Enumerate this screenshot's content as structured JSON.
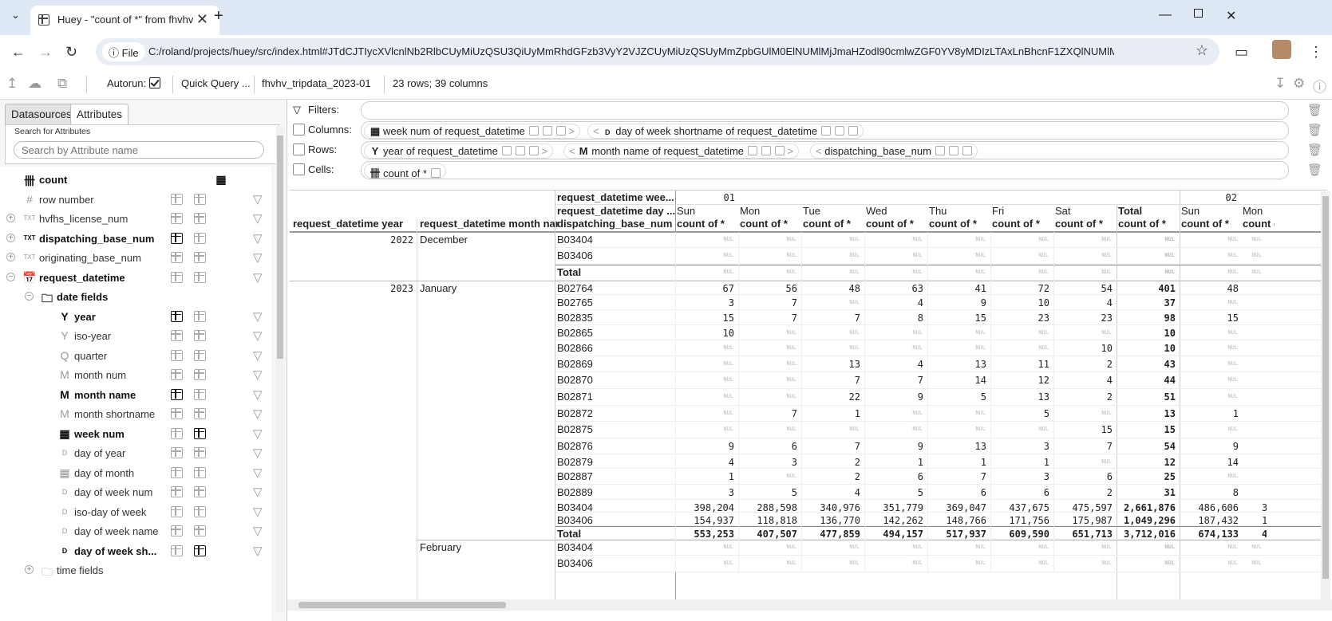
{
  "browser": {
    "tab_title": "Huey - \"count of *\" from fhvhv_",
    "url_chip": "File",
    "url": "C:/roland/projects/huey/src/index.html#JTdCJTIycXVlcnlNb2RlbCUyMiUzQSU3QiUyMmRhdGFzb3VyY2VJZCUyMiUzQSUyMmZpbGUlM0ElNUMlMjJmaHZodl90cmlwZGF0YV8yMDIzLTAxLnBhcnF1ZXQlNUMlMjIl..."
  },
  "app_toolbar": {
    "autorun_label": "Autorun:",
    "quick_query": "Quick Query ...",
    "datasource": "fhvhv_tripdata_2023-01",
    "row_info": "23 rows; 39 columns"
  },
  "sidebar": {
    "tabs": [
      "Datasources",
      "Attributes"
    ],
    "search_label": "Search for Attributes",
    "search_placeholder": "Search by Attribute name",
    "items": [
      {
        "label": "count",
        "icon": "count-icon",
        "glyph": "卌",
        "bold": true,
        "indent": 0
      },
      {
        "label": "row number",
        "icon": "hash-icon",
        "glyph": "#",
        "bold": false,
        "indent": 0
      },
      {
        "label": "hvfhs_license_num",
        "icon": "text-icon",
        "glyph": "TXT",
        "bold": false,
        "indent": 0
      },
      {
        "label": "dispatching_base_num",
        "icon": "text-icon",
        "glyph": "TXT",
        "bold": true,
        "indent": 0
      },
      {
        "label": "originating_base_num",
        "icon": "text-icon",
        "glyph": "TXT",
        "bold": false,
        "indent": 0
      },
      {
        "label": "request_datetime",
        "icon": "datetime-icon",
        "glyph": "📅",
        "bold": true,
        "indent": 0
      },
      {
        "label": "date fields",
        "icon": "folder-icon",
        "glyph": "🗀",
        "bold": true,
        "indent": 1
      },
      {
        "label": "year",
        "icon": "year-icon",
        "glyph": "Y",
        "bold": true,
        "indent": 2
      },
      {
        "label": "iso-year",
        "icon": "year-icon",
        "glyph": "Y",
        "bold": false,
        "indent": 2
      },
      {
        "label": "quarter",
        "icon": "quarter-icon",
        "glyph": "Q",
        "bold": false,
        "indent": 2
      },
      {
        "label": "month num",
        "icon": "month-icon",
        "glyph": "M",
        "bold": false,
        "indent": 2
      },
      {
        "label": "month name",
        "icon": "month-icon",
        "glyph": "M",
        "bold": true,
        "indent": 2
      },
      {
        "label": "month shortname",
        "icon": "month-icon",
        "glyph": "M",
        "bold": false,
        "indent": 2
      },
      {
        "label": "week num",
        "icon": "calendar-icon",
        "glyph": "▦",
        "bold": true,
        "indent": 2
      },
      {
        "label": "day of year",
        "icon": "day-icon",
        "glyph": "D",
        "bold": false,
        "indent": 2
      },
      {
        "label": "day of month",
        "icon": "calendar-icon",
        "glyph": "▦",
        "bold": false,
        "indent": 2
      },
      {
        "label": "day of week num",
        "icon": "day-icon",
        "glyph": "D",
        "bold": false,
        "indent": 2
      },
      {
        "label": "iso-day of week",
        "icon": "day-icon",
        "glyph": "D",
        "bold": false,
        "indent": 2
      },
      {
        "label": "day of week name",
        "icon": "day-icon",
        "glyph": "D",
        "bold": false,
        "indent": 2
      },
      {
        "label": "day of week sh...",
        "icon": "day-icon",
        "glyph": "D",
        "bold": true,
        "indent": 2
      },
      {
        "label": "time fields",
        "icon": "folder-icon",
        "glyph": "🗀",
        "bold": false,
        "indent": 1
      }
    ]
  },
  "query": {
    "filters_label": "Filters:",
    "columns_label": "Columns:",
    "rows_label": "Rows:",
    "cells_label": "Cells:",
    "columns": [
      "week num of request_datetime",
      "day of week shortname of request_datetime"
    ],
    "rows": [
      "year of request_datetime",
      "month name of request_datetime",
      "dispatching_base_num"
    ],
    "cells": [
      "count of *"
    ]
  },
  "pivot": {
    "col_header_week": "request_datetime wee...",
    "col_header_day": "request_datetime day ...",
    "row_headers": [
      "request_datetime year",
      "request_datetime month name",
      "dispatching_base_num"
    ],
    "week1": "01",
    "week2": "02",
    "days": [
      "Sun",
      "Mon",
      "Tue",
      "Wed",
      "Thu",
      "Fri",
      "Sat"
    ],
    "total_label": "Total",
    "measure": "count of *",
    "nul": "NUL",
    "week2_days": [
      "Sun",
      "Mon"
    ],
    "year_2022": "2022",
    "year_2023": "2023",
    "month_dec": "December",
    "month_jan": "January",
    "month_feb": "February",
    "rows": [
      {
        "base": "B03404",
        "v": [
          null,
          null,
          null,
          null,
          null,
          null,
          null
        ],
        "tot": null,
        "w2": [
          null,
          null
        ]
      },
      {
        "base": "B03406",
        "v": [
          null,
          null,
          null,
          null,
          null,
          null,
          null
        ],
        "tot": null,
        "w2": [
          null,
          null
        ]
      },
      {
        "base": "Total",
        "v": [
          null,
          null,
          null,
          null,
          null,
          null,
          null
        ],
        "tot": null,
        "w2": [
          null,
          null
        ]
      },
      {
        "base": "B02764",
        "v": [
          "67",
          "56",
          "48",
          "63",
          "41",
          "72",
          "54"
        ],
        "tot": "401",
        "w2": [
          "48",
          ""
        ]
      },
      {
        "base": "B02765",
        "v": [
          "3",
          "7",
          null,
          "4",
          "9",
          "10",
          "4"
        ],
        "tot": "37",
        "w2": [
          null,
          ""
        ]
      },
      {
        "base": "B02835",
        "v": [
          "15",
          "7",
          "7",
          "8",
          "15",
          "23",
          "23"
        ],
        "tot": "98",
        "w2": [
          "15",
          ""
        ]
      },
      {
        "base": "B02865",
        "v": [
          "10",
          null,
          null,
          null,
          null,
          null,
          null
        ],
        "tot": "10",
        "w2": [
          null,
          ""
        ]
      },
      {
        "base": "B02866",
        "v": [
          null,
          null,
          null,
          null,
          null,
          null,
          "10"
        ],
        "tot": "10",
        "w2": [
          null,
          ""
        ]
      },
      {
        "base": "B02869",
        "v": [
          null,
          null,
          "13",
          "4",
          "13",
          "11",
          "2"
        ],
        "tot": "43",
        "w2": [
          null,
          ""
        ]
      },
      {
        "base": "B02870",
        "v": [
          null,
          null,
          "7",
          "7",
          "14",
          "12",
          "4"
        ],
        "tot": "44",
        "w2": [
          null,
          ""
        ]
      },
      {
        "base": "B02871",
        "v": [
          null,
          null,
          "22",
          "9",
          "5",
          "13",
          "2"
        ],
        "tot": "51",
        "w2": [
          null,
          ""
        ]
      },
      {
        "base": "B02872",
        "v": [
          null,
          "7",
          "1",
          null,
          null,
          "5",
          null
        ],
        "tot": "13",
        "w2": [
          "1",
          ""
        ]
      },
      {
        "base": "B02875",
        "v": [
          null,
          null,
          null,
          null,
          null,
          null,
          "15"
        ],
        "tot": "15",
        "w2": [
          null,
          ""
        ]
      },
      {
        "base": "B02876",
        "v": [
          "9",
          "6",
          "7",
          "9",
          "13",
          "3",
          "7"
        ],
        "tot": "54",
        "w2": [
          "9",
          ""
        ]
      },
      {
        "base": "B02879",
        "v": [
          "4",
          "3",
          "2",
          "1",
          "1",
          "1",
          null
        ],
        "tot": "12",
        "w2": [
          "14",
          ""
        ]
      },
      {
        "base": "B02887",
        "v": [
          "1",
          null,
          "2",
          "6",
          "7",
          "3",
          "6"
        ],
        "tot": "25",
        "w2": [
          null,
          ""
        ]
      },
      {
        "base": "B02889",
        "v": [
          "3",
          "5",
          "4",
          "5",
          "6",
          "6",
          "2"
        ],
        "tot": "31",
        "w2": [
          "8",
          ""
        ]
      },
      {
        "base": "B03404",
        "v": [
          "398,204",
          "288,598",
          "340,976",
          "351,779",
          "369,047",
          "437,675",
          "475,597"
        ],
        "tot": "2,661,876",
        "w2": [
          "486,606",
          "3"
        ]
      },
      {
        "base": "B03406",
        "v": [
          "154,937",
          "118,818",
          "136,770",
          "142,262",
          "148,766",
          "171,756",
          "175,987"
        ],
        "tot": "1,049,296",
        "w2": [
          "187,432",
          "1"
        ]
      },
      {
        "base": "Total",
        "v": [
          "553,253",
          "407,507",
          "477,859",
          "494,157",
          "517,937",
          "609,590",
          "651,713"
        ],
        "tot": "3,712,016",
        "w2": [
          "674,133",
          "4"
        ]
      },
      {
        "base": "B03404",
        "v": [
          null,
          null,
          null,
          null,
          null,
          null,
          null
        ],
        "tot": null,
        "w2": [
          null,
          null
        ]
      },
      {
        "base": "B03406",
        "v": [
          null,
          null,
          null,
          null,
          null,
          null,
          null
        ],
        "tot": null,
        "w2": [
          null,
          null
        ]
      }
    ]
  }
}
